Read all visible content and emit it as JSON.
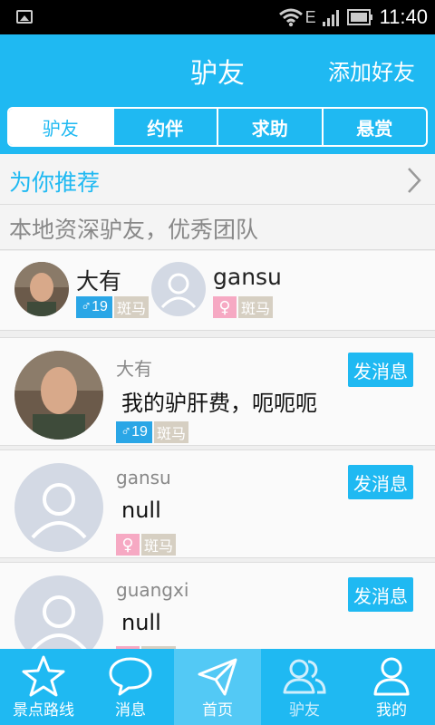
{
  "status": {
    "time": "11:40",
    "network": "E"
  },
  "header": {
    "title": "驴友",
    "action": "添加好友"
  },
  "tabs": [
    {
      "label": "驴友"
    },
    {
      "label": "约伴"
    },
    {
      "label": "求助"
    },
    {
      "label": "悬赏"
    }
  ],
  "recommend": {
    "label": "为你推荐"
  },
  "local": {
    "label": "本地资深驴友，优秀团队"
  },
  "quick_users": [
    {
      "name": "大有",
      "gender": "♂",
      "age": "19",
      "tag": "斑马"
    },
    {
      "name": "gansu",
      "gender": "♀",
      "age": "",
      "tag": "斑马"
    }
  ],
  "list": [
    {
      "nick": "大有",
      "message": "我的驴肝费，呃呃呃",
      "gender": "♂",
      "age": "19",
      "tag": "斑马",
      "action": "发消息"
    },
    {
      "nick": "gansu",
      "message": "null",
      "gender": "♀",
      "age": "",
      "tag": "斑马",
      "action": "发消息"
    },
    {
      "nick": "guangxi",
      "message": "null",
      "gender": "♀",
      "age": "",
      "tag": "斑马",
      "action": "发消息"
    }
  ],
  "bottom_nav": [
    {
      "label": "景点路线",
      "icon": "star-icon"
    },
    {
      "label": "消息",
      "icon": "chat-bubble-icon"
    },
    {
      "label": "首页",
      "icon": "paper-plane-icon"
    },
    {
      "label": "驴友",
      "icon": "friends-icon"
    },
    {
      "label": "我的",
      "icon": "person-icon"
    }
  ],
  "colors": {
    "primary": "#1fb9f2",
    "male": "#2aa6e6",
    "female": "#f6a9c3",
    "zebra": "#d6cfc2"
  }
}
